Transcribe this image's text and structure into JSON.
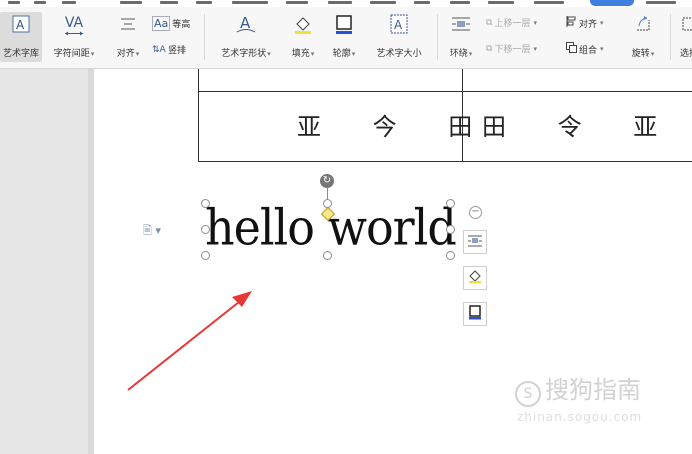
{
  "ribbon": {
    "art_library": "艺术字库",
    "char_spacing": "字符间距",
    "align_text": "对齐",
    "equal_height": "等高",
    "vertical": "竖排",
    "wordart_shape": "艺术字形状",
    "fill": "填充",
    "outline": "轮廓",
    "wordart_size": "艺术字大小",
    "wrap": "环绕",
    "bring_forward": "上移一层",
    "send_backward": "下移一层",
    "align": "对齐",
    "group": "组合",
    "rotate": "旋转",
    "select": "选择",
    "va_glyph": "VA",
    "aa_glyph": "Aa",
    "accent_color": "#3f7fe0"
  },
  "document": {
    "table_left_cell": "亚 今 田",
    "table_right_cell": "田 令 亚",
    "wordart_text": "hello world"
  },
  "watermark": {
    "brand": "搜狗指南",
    "site": "zhinan.sogou.com"
  },
  "annotation": {
    "arrow_color": "#e53935"
  }
}
